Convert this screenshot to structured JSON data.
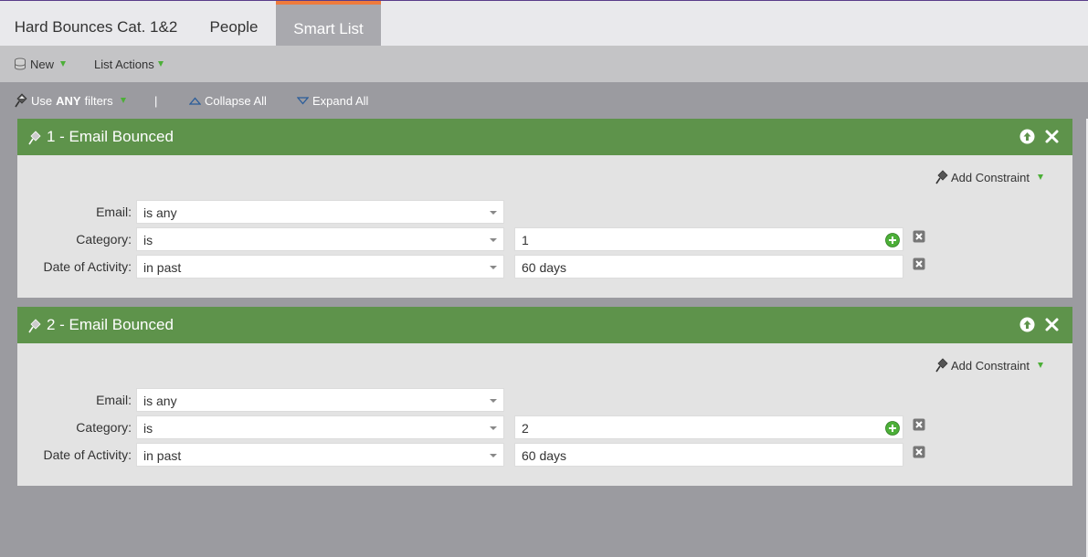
{
  "tabs": [
    {
      "label": "Hard Bounces Cat. 1&2",
      "active": false
    },
    {
      "label": "People",
      "active": false
    },
    {
      "label": "Smart List",
      "active": true
    }
  ],
  "toolbar": {
    "new_label": "New",
    "list_actions_label": "List Actions"
  },
  "filter_controls": {
    "use_prefix": "Use",
    "use_mode": "ANY",
    "use_suffix": "filters",
    "separator": "|",
    "collapse_all": "Collapse All",
    "expand_all": "Expand All"
  },
  "filters": [
    {
      "title": "1 - Email Bounced",
      "add_constraint": "Add Constraint",
      "rows": [
        {
          "label": "Email:",
          "operator": "is any"
        },
        {
          "label": "Category:",
          "operator": "is",
          "value": "1"
        },
        {
          "label": "Date of Activity:",
          "operator": "in past",
          "value": "60 days"
        }
      ]
    },
    {
      "title": "2 - Email Bounced",
      "add_constraint": "Add Constraint",
      "rows": [
        {
          "label": "Email:",
          "operator": "is any"
        },
        {
          "label": "Category:",
          "operator": "is",
          "value": "2"
        },
        {
          "label": "Date of Activity:",
          "operator": "in past",
          "value": "60 days"
        }
      ]
    }
  ],
  "colors": {
    "panel_header": "#5e934b",
    "active_tab_accent": "#ef7b3c",
    "dropdown_arrow": "#4caf38"
  },
  "icons": [
    "database-icon",
    "pin-icon",
    "collapse-icon",
    "expand-icon",
    "move-up-icon",
    "close-icon",
    "add-value-icon",
    "delete-row-icon"
  ]
}
